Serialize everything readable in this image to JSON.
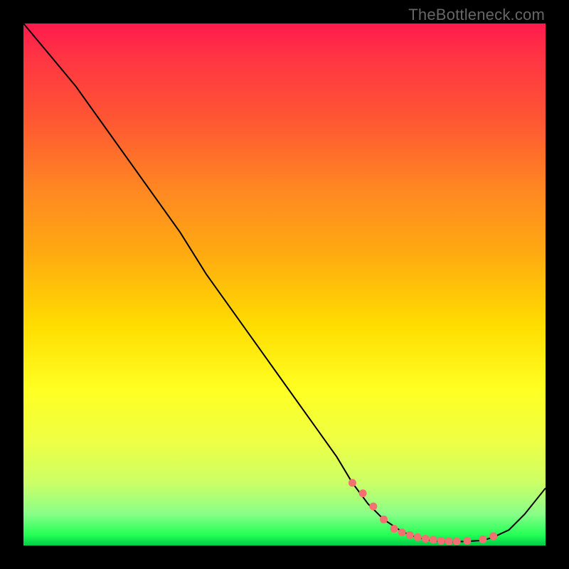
{
  "watermark": "TheBottleneck.com",
  "chart_data": {
    "type": "line",
    "title": "",
    "xlabel": "",
    "ylabel": "",
    "xlim": [
      0,
      100
    ],
    "ylim": [
      0,
      100
    ],
    "series": [
      {
        "name": "bottleneck-curve",
        "x": [
          0,
          5,
          10,
          15,
          20,
          25,
          30,
          35,
          40,
          45,
          50,
          55,
          60,
          63,
          66,
          69,
          72,
          74,
          76,
          78,
          80,
          82,
          85,
          88,
          90,
          93,
          96,
          100
        ],
        "y": [
          100,
          94,
          88,
          81,
          74,
          67,
          60,
          52,
          45,
          38,
          31,
          24,
          17,
          12,
          8,
          5,
          3,
          2,
          1.4,
          1,
          0.8,
          0.7,
          0.8,
          1,
          1.6,
          3,
          6,
          11
        ]
      }
    ],
    "markers": {
      "name": "highlight-dots",
      "color": "#f37070",
      "x": [
        63,
        65,
        67,
        69,
        71,
        72.5,
        74,
        75.5,
        77,
        78.5,
        80,
        81.5,
        83,
        85,
        88,
        90
      ],
      "y": [
        12,
        10,
        7.5,
        5,
        3.2,
        2.5,
        2,
        1.6,
        1.3,
        1.1,
        0.9,
        0.8,
        0.8,
        0.9,
        1.2,
        1.8
      ]
    }
  }
}
